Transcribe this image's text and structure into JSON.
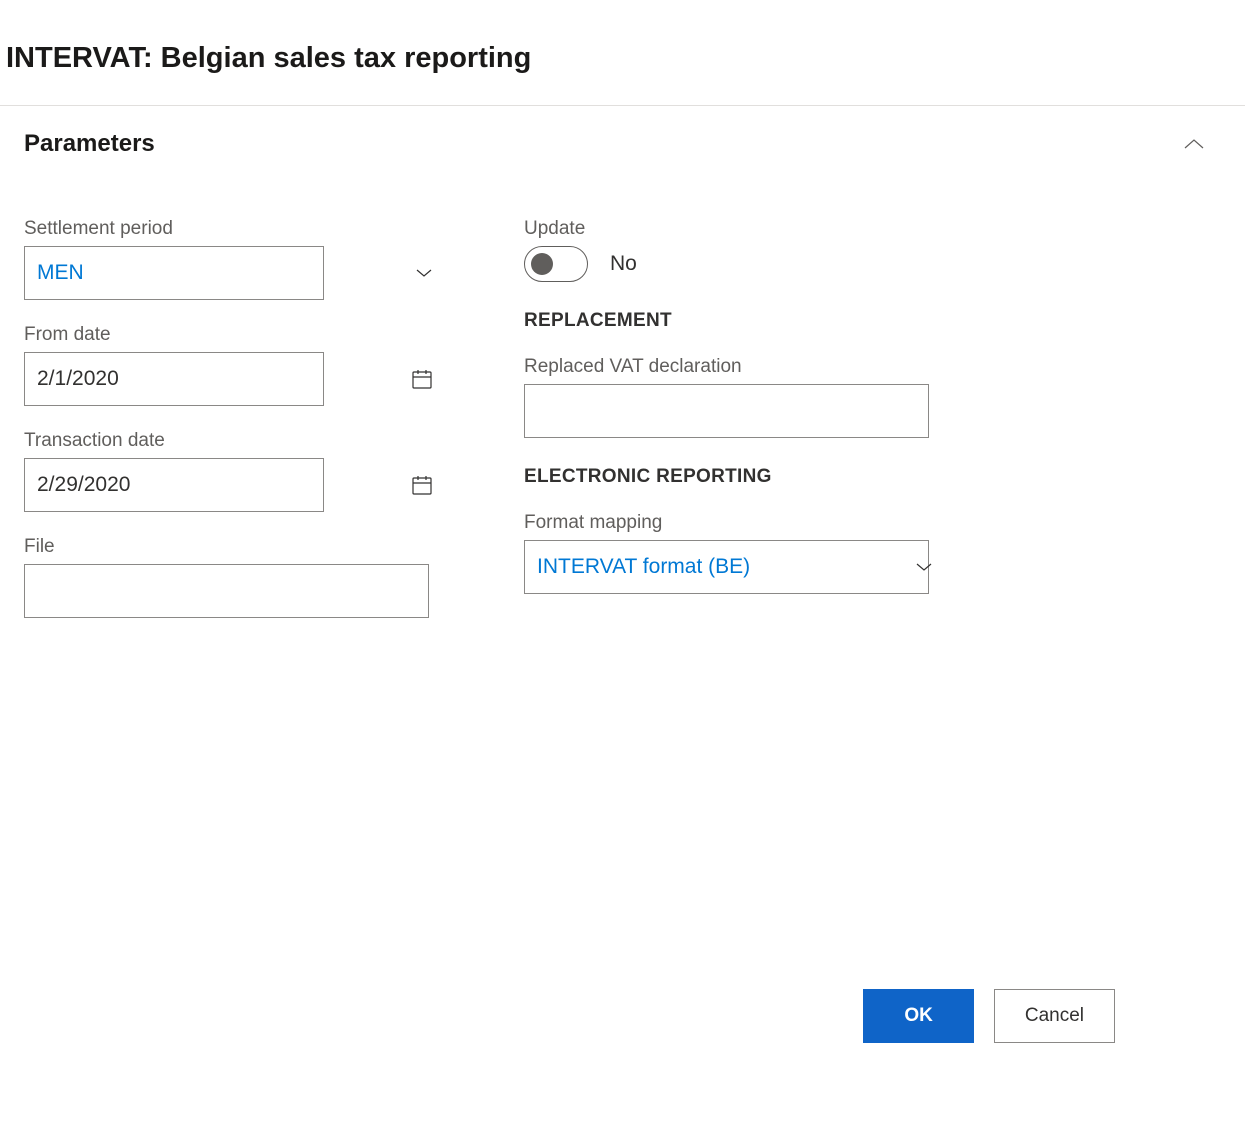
{
  "header": {
    "title": "INTERVAT: Belgian sales tax reporting"
  },
  "section": {
    "title": "Parameters"
  },
  "left": {
    "settlement_period": {
      "label": "Settlement period",
      "value": "MEN"
    },
    "from_date": {
      "label": "From date",
      "value": "2/1/2020"
    },
    "transaction_date": {
      "label": "Transaction date",
      "value": "2/29/2020"
    },
    "file": {
      "label": "File",
      "value": ""
    }
  },
  "right": {
    "update": {
      "label": "Update",
      "value_text": "No"
    },
    "replacement": {
      "group_label": "REPLACEMENT",
      "replaced_vat": {
        "label": "Replaced VAT declaration",
        "value": ""
      }
    },
    "electronic_reporting": {
      "group_label": "ELECTRONIC REPORTING",
      "format_mapping": {
        "label": "Format mapping",
        "value": "INTERVAT format (BE)"
      }
    }
  },
  "footer": {
    "ok_label": "OK",
    "cancel_label": "Cancel"
  }
}
